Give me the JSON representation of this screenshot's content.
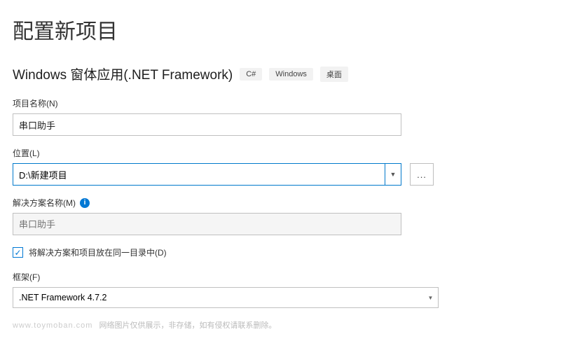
{
  "header": {
    "title": "配置新项目",
    "template_name": "Windows 窗体应用(.NET Framework)",
    "tags": [
      "C#",
      "Windows",
      "桌面"
    ]
  },
  "fields": {
    "project_name": {
      "label": "项目名称(N)",
      "value": "串口助手"
    },
    "location": {
      "label": "位置(L)",
      "value": "D:\\新建项目",
      "browse": "..."
    },
    "solution_name": {
      "label": "解决方案名称(M)",
      "placeholder": "串口助手"
    },
    "same_dir": {
      "checked": true,
      "label": "将解决方案和项目放在同一目录中(D)"
    },
    "framework": {
      "label": "框架(F)",
      "value": ".NET Framework 4.7.2"
    }
  },
  "watermark": {
    "domain": "www.toymoban.com",
    "text": "网络图片仅供展示，非存储，如有侵权请联系删除。"
  }
}
